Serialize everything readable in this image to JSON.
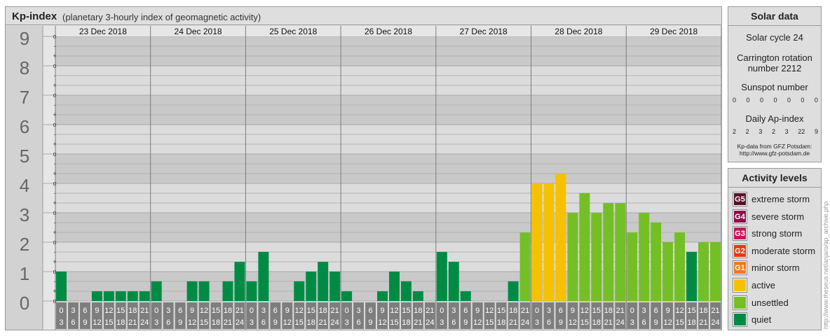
{
  "header": {
    "title": "Kp-index",
    "subtitle": "(planetary 3-hourly index of geomagnetic activity)"
  },
  "chart_data": {
    "type": "bar",
    "title": "Kp-index",
    "subtitle": "(planetary 3-hourly index of geomagnetic activity)",
    "ylim": [
      0,
      9
    ],
    "y_major_ticks": [
      "0",
      "1",
      "2",
      "3",
      "4",
      "5",
      "6",
      "7",
      "8",
      "9"
    ],
    "y_minor_ticks": [
      "-",
      "o",
      "+"
    ],
    "days": [
      "23 Dec 2018",
      "24 Dec 2018",
      "25 Dec 2018",
      "26 Dec 2018",
      "27 Dec 2018",
      "28 Dec 2018",
      "29 Dec 2018"
    ],
    "interval_labels": [
      [
        "0",
        "3"
      ],
      [
        "3",
        "6"
      ],
      [
        "6",
        "9"
      ],
      [
        "9",
        "12"
      ],
      [
        "12",
        "15"
      ],
      [
        "15",
        "18"
      ],
      [
        "18",
        "21"
      ],
      [
        "21",
        "24"
      ]
    ],
    "values": [
      [
        1,
        0,
        0,
        0.33,
        0.33,
        0.33,
        0.33,
        0.33
      ],
      [
        0.67,
        0,
        0,
        0.67,
        0.67,
        0,
        0.67,
        1.33
      ],
      [
        0.67,
        1.67,
        0,
        0,
        0.67,
        1,
        1.33,
        1
      ],
      [
        0.33,
        0,
        0,
        0.33,
        1,
        0.67,
        0.33,
        0
      ],
      [
        1.67,
        1.33,
        0.33,
        0,
        0,
        0,
        0.67,
        2.33
      ],
      [
        4,
        4,
        4.33,
        3,
        3.67,
        3,
        3.33,
        3.33
      ],
      [
        2.33,
        3,
        2.67,
        2,
        2.33,
        1.67,
        2,
        2
      ]
    ],
    "level_colors": {
      "quiet": "#008b45",
      "unsettled": "#74bf25",
      "active": "#f6c100"
    },
    "grid": true
  },
  "solar": {
    "title": "Solar data",
    "cycle": "Solar cycle 24",
    "carrington_line1": "Carrington rotation",
    "carrington_line2": "number 2212",
    "sunspot_label": "Sunspot number",
    "sunspot_values": [
      "0",
      "0",
      "0",
      "0",
      "0",
      "0",
      "0"
    ],
    "ap_label": "Daily Ap-index",
    "ap_values": [
      "2",
      "2",
      "3",
      "2",
      "3",
      "22",
      "9"
    ],
    "credit_line1": "Kp-data from GFZ Potsdam:",
    "credit_line2": "http://www.gfz-potsdam.de"
  },
  "levels": {
    "title": "Activity levels",
    "items": [
      {
        "badge": "G5",
        "label": "extreme storm",
        "color": "#5a0f2a"
      },
      {
        "badge": "G4",
        "label": "severe storm",
        "color": "#8b1048"
      },
      {
        "badge": "G3",
        "label": "strong storm",
        "color": "#c2185b"
      },
      {
        "badge": "G2",
        "label": "moderate storm",
        "color": "#dd3b16"
      },
      {
        "badge": "G1",
        "label": "minor storm",
        "color": "#ec7b1c"
      },
      {
        "badge": "",
        "label": "active",
        "color": "#f6c100"
      },
      {
        "badge": "",
        "label": "unsettled",
        "color": "#74bf25"
      },
      {
        "badge": "",
        "label": "quiet",
        "color": "#008b45"
      }
    ]
  },
  "watermark": "http://www.theseus.net/anjaro/ap_archive.php"
}
